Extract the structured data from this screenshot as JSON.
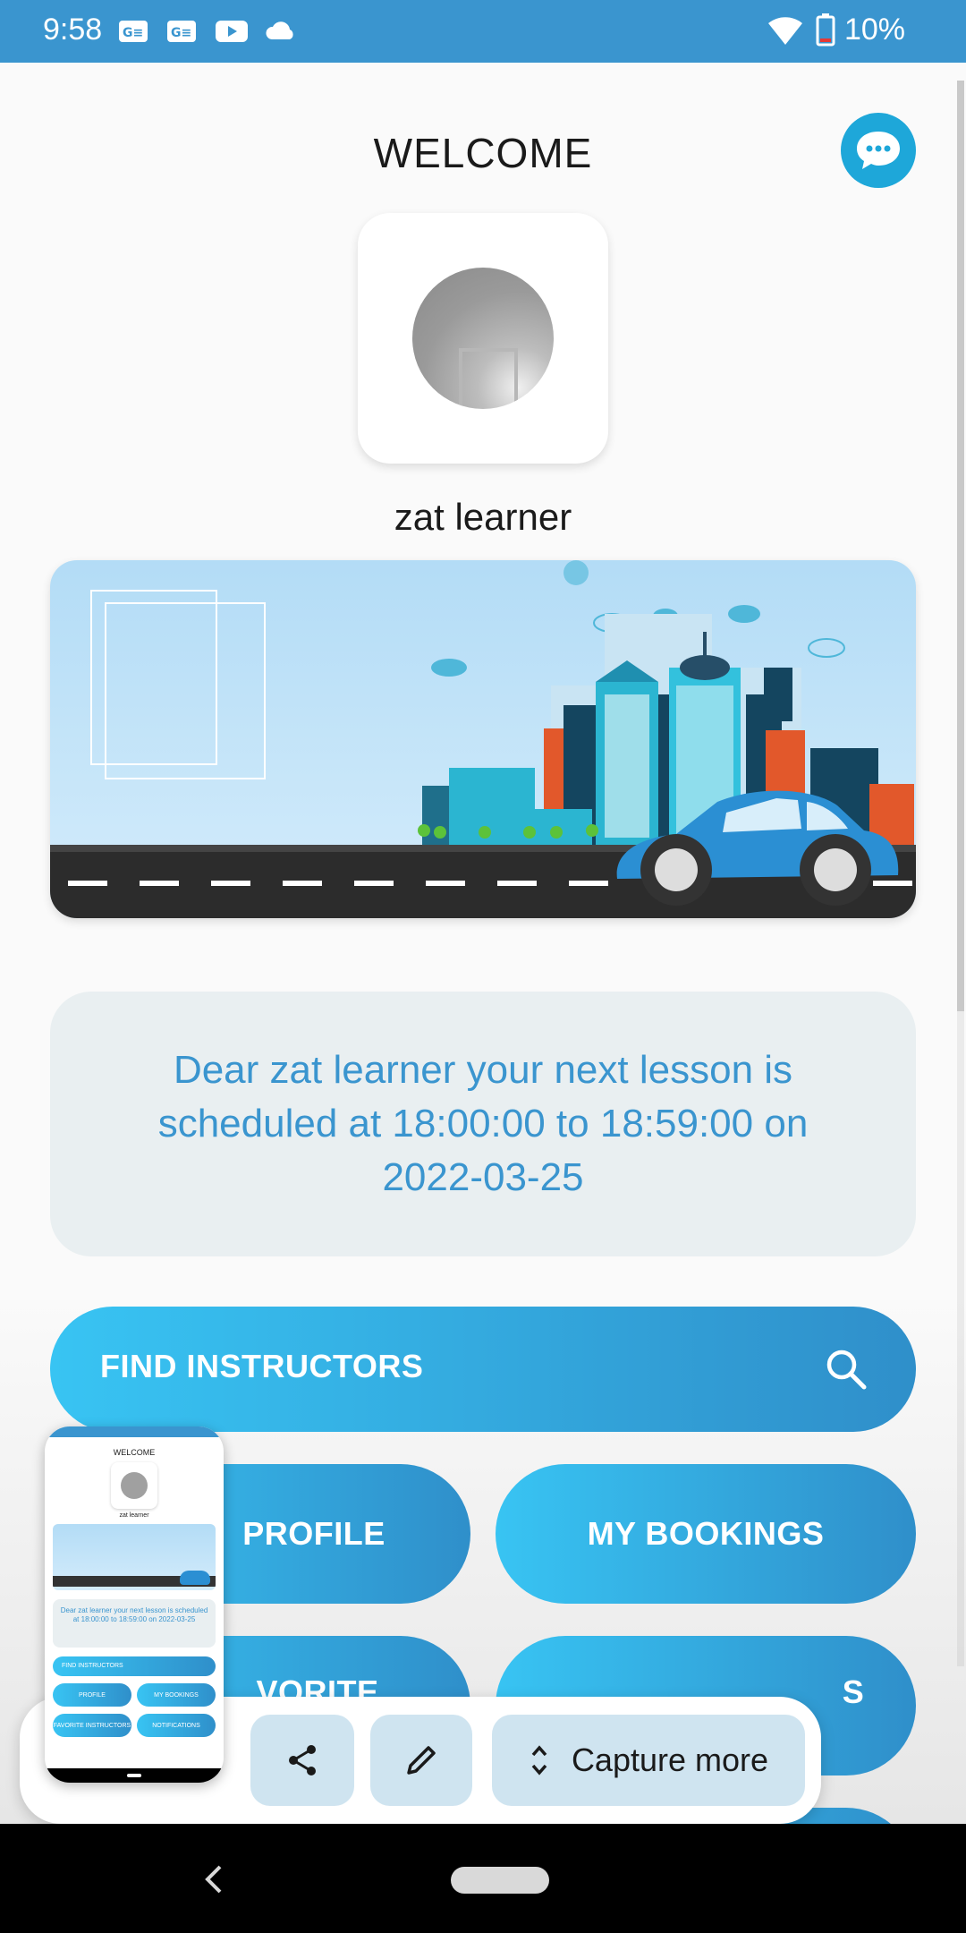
{
  "status_bar": {
    "time": "9:58",
    "battery": "10%",
    "notification_icons": [
      "news-icon",
      "news-icon",
      "youtube-icon",
      "cloud-icon"
    ],
    "system_icons": [
      "wifi-icon",
      "battery-icon"
    ]
  },
  "header": {
    "title": "WELCOME",
    "chat_icon": "chat-bubble-icon"
  },
  "profile": {
    "name": "zat learner"
  },
  "lesson_notice": {
    "text": "Dear zat learner your next lesson is scheduled at 18:00:00 to 18:59:00 on 2022-03-25"
  },
  "actions": {
    "find_instructors": "FIND INSTRUCTORS",
    "my_profile": "PROFILE",
    "my_bookings": "MY BOOKINGS",
    "favorite": "VORITE",
    "notifications": "S"
  },
  "capture_toolbar": {
    "share_icon": "share-icon",
    "edit_icon": "pencil-icon",
    "capture_more": "Capture more"
  },
  "thumbnail": {
    "welcome": "WELCOME",
    "name": "zat learner",
    "lesson": "Dear zat learner your next lesson is scheduled at 18:00:00 to 18:59:00 on 2022-03-25",
    "find": "FIND INSTRUCTORS",
    "profile": "PROFILE",
    "bookings": "MY BOOKINGS",
    "favorite": "FAVORITE INSTRUCTORS",
    "notifications": "NOTIFICATIONS"
  },
  "colors": {
    "status_bar": "#3a95cf",
    "accent": "#3a95cf",
    "button_start": "#38c4f3",
    "button_end": "#2f8fca",
    "chat_button": "#1ea7d9",
    "lesson_card": "#e9eff1"
  }
}
